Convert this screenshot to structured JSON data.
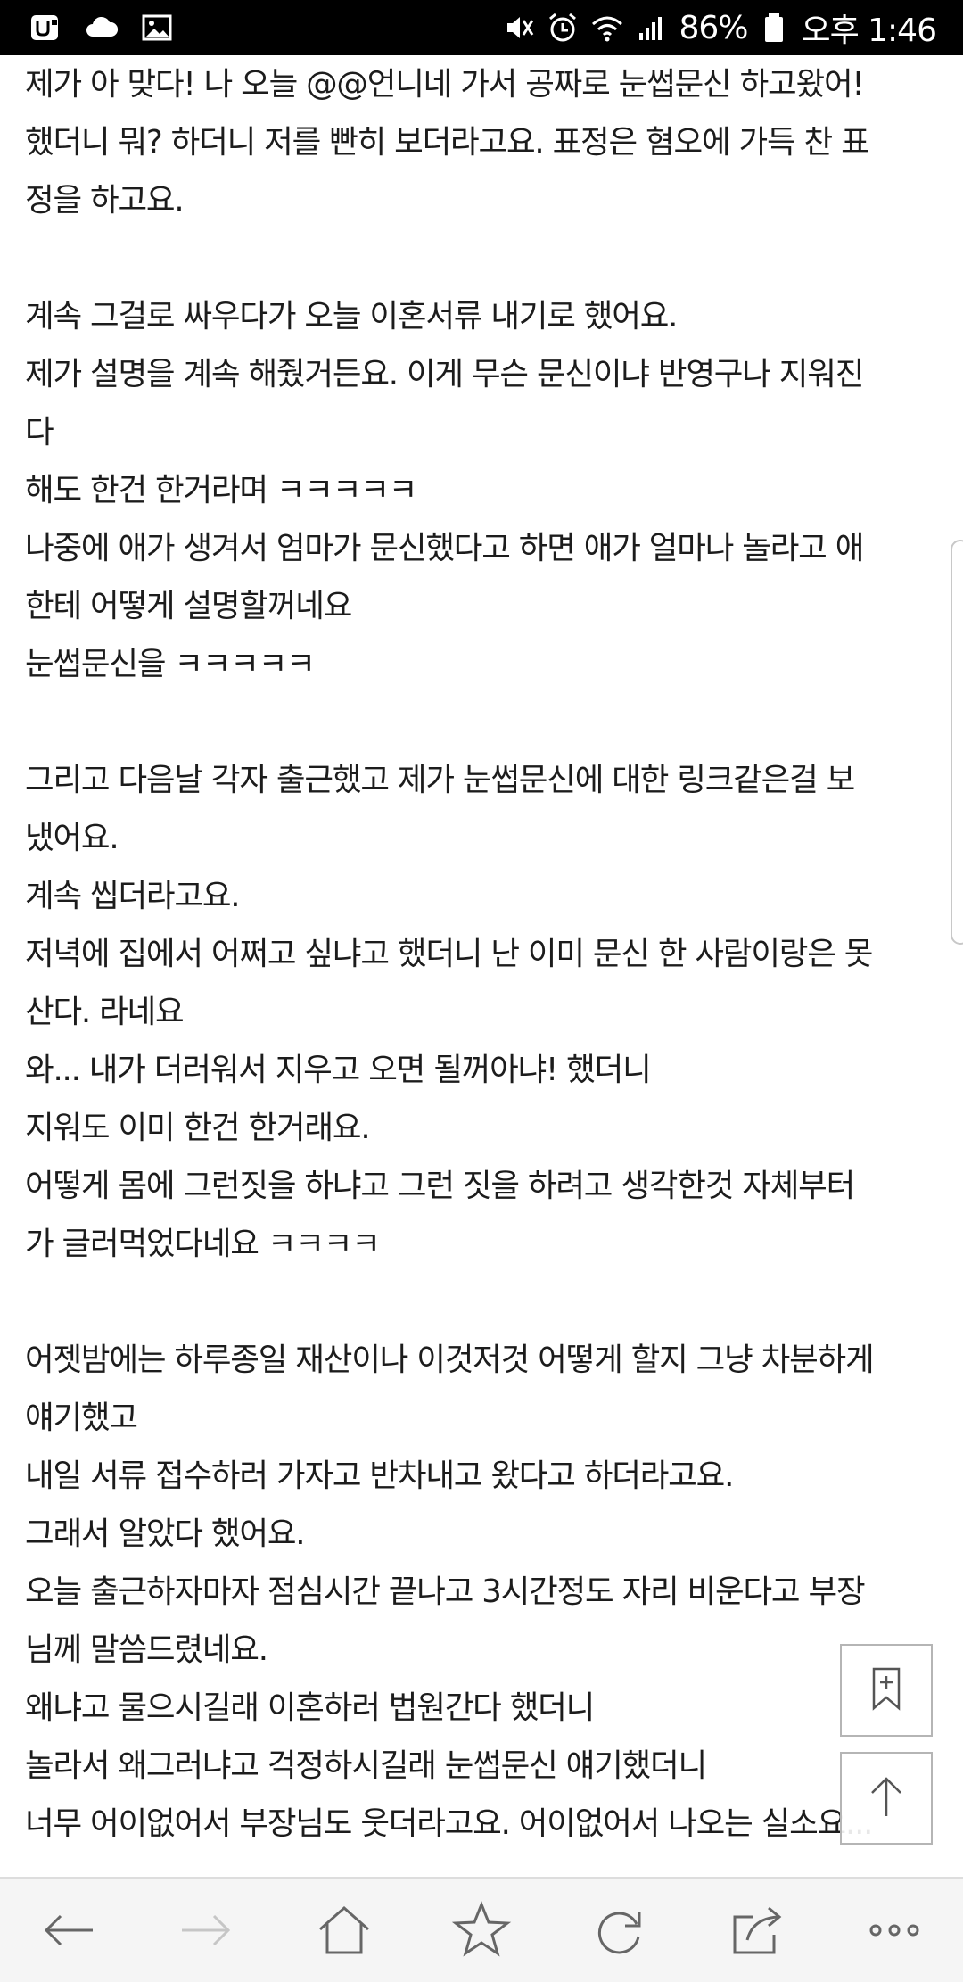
{
  "status_bar": {
    "battery_percent": "86%",
    "time": "오후 1:46",
    "left_icons": [
      "app-notification-icon",
      "cloud-icon",
      "image-icon"
    ],
    "right_icons": [
      "mute-icon",
      "alarm-icon",
      "wifi-icon",
      "signal-icon",
      "battery-icon"
    ]
  },
  "article": {
    "lines": [
      "제가 아 맞다! 나 오늘 @@언니네 가서 공짜로 눈썹문신 하고왔어!",
      "했더니 뭐? 하더니 저를 빤히 보더라고요. 표정은 혐오에 가득 찬 표",
      "정을 하고요.",
      "",
      "계속 그걸로 싸우다가 오늘 이혼서류 내기로 했어요.",
      "제가 설명을 계속 해줬거든요. 이게 무슨 문신이냐 반영구나 지워진",
      "다",
      "해도 한건 한거라며 ㅋㅋㅋㅋㅋ",
      "나중에 애가 생겨서 엄마가 문신했다고 하면 애가 얼마나 놀라고 애",
      "한테 어떻게 설명할꺼네요",
      "눈썹문신을 ㅋㅋㅋㅋㅋ",
      "",
      "그리고 다음날 각자 출근했고 제가 눈썹문신에 대한 링크같은걸 보",
      "냈어요.",
      "계속 씹더라고요.",
      "저녁에 집에서 어쩌고 싶냐고 했더니 난 이미 문신 한 사람이랑은 못",
      "산다. 라네요",
      "와... 내가 더러워서 지우고 오면 될꺼아냐! 했더니",
      "지워도 이미 한건 한거래요.",
      "어떻게 몸에 그런짓을 하냐고 그런 짓을 하려고 생각한것 자체부터",
      "가 글러먹었다네요 ㅋㅋㅋㅋ",
      "",
      "어젯밤에는 하루종일 재산이나 이것저것 어떻게 할지 그냥 차분하게",
      "얘기했고",
      "내일 서류 접수하러 가자고 반차내고 왔다고 하더라고요.",
      "그래서 알았다 했어요.",
      "오늘 출근하자마자 점심시간 끝나고 3시간정도 자리 비운다고 부장",
      "님께 말씀드렸네요.",
      "왜냐고 물으시길래 이혼하러 법원간다 했더니",
      "놀라서 왜그러냐고 걱정하시길래 눈썹문신 얘기했더니",
      "너무 어이없어서 부장님도 웃더라고요. 어이없어서 나오는 실소요..."
    ]
  },
  "floating_buttons": [
    "bookmark-add-icon",
    "scroll-to-top-icon"
  ],
  "toolbar": {
    "buttons": [
      "back-icon",
      "forward-icon",
      "home-icon",
      "bookmarks-icon",
      "refresh-icon",
      "share-icon",
      "more-icon"
    ]
  }
}
